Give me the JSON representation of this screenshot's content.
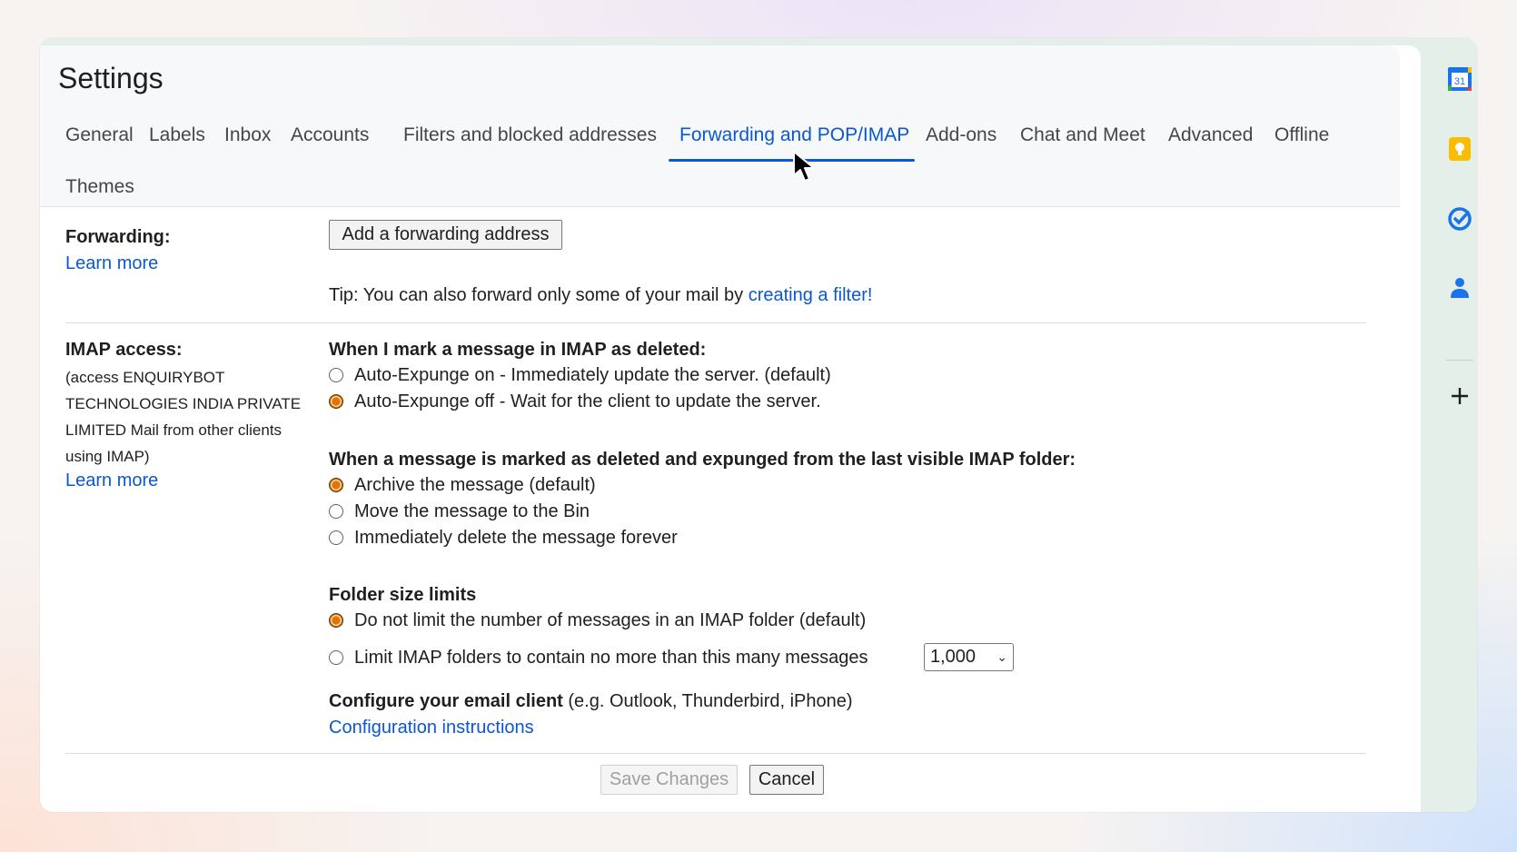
{
  "page": {
    "title": "Settings"
  },
  "tabs": [
    {
      "label": "General"
    },
    {
      "label": "Labels"
    },
    {
      "label": "Inbox"
    },
    {
      "label": "Accounts"
    },
    {
      "label": "Filters and blocked addresses"
    },
    {
      "label": "Forwarding and POP/IMAP",
      "active": true
    },
    {
      "label": "Add-ons"
    },
    {
      "label": "Chat and Meet"
    },
    {
      "label": "Advanced"
    },
    {
      "label": "Offline"
    },
    {
      "label": "Themes"
    }
  ],
  "forwarding": {
    "label": "Forwarding:",
    "learn_more": "Learn more",
    "add_button": "Add a forwarding address",
    "tip_text": "Tip: You can also forward only some of your mail by",
    "tip_link": "creating a filter!"
  },
  "imap": {
    "label": "IMAP access:",
    "description": "(access ENQUIRYBOT TECHNOLOGIES INDIA PRIVATE LIMITED Mail from other clients using IMAP)",
    "learn_more": "Learn more",
    "deleted_heading": "When I mark a message in IMAP as deleted:",
    "deleted_options": [
      {
        "label": "Auto-Expunge on - Immediately update the server. (default)",
        "checked": false
      },
      {
        "label": "Auto-Expunge off - Wait for the client to update the server.",
        "checked": true
      }
    ],
    "expunged_heading": "When a message is marked as deleted and expunged from the last visible IMAP folder:",
    "expunged_options": [
      {
        "label": "Archive the message (default)",
        "checked": true
      },
      {
        "label": "Move the message to the Bin",
        "checked": false
      },
      {
        "label": "Immediately delete the message forever",
        "checked": false
      }
    ],
    "folder_heading": "Folder size limits",
    "folder_options": [
      {
        "label": "Do not limit the number of messages in an IMAP folder (default)",
        "checked": true
      },
      {
        "label": "Limit IMAP folders to contain no more than this many messages",
        "checked": false
      }
    ],
    "folder_limit_value": "1,000",
    "configure_heading": "Configure your email client",
    "configure_hint": "(e.g. Outlook, Thunderbird, iPhone)",
    "configure_link": "Configuration instructions"
  },
  "footer": {
    "save": "Save Changes",
    "cancel": "Cancel"
  },
  "rail": {
    "calendar_day": "31",
    "icons": [
      "calendar-icon",
      "keep-icon",
      "tasks-icon",
      "contacts-icon",
      "add-icon"
    ]
  },
  "colors": {
    "accent": "#0b57d0",
    "radio_checked": "#e37400",
    "header_bg": "#f6f8fa",
    "rail_bg": "#e5efea"
  }
}
